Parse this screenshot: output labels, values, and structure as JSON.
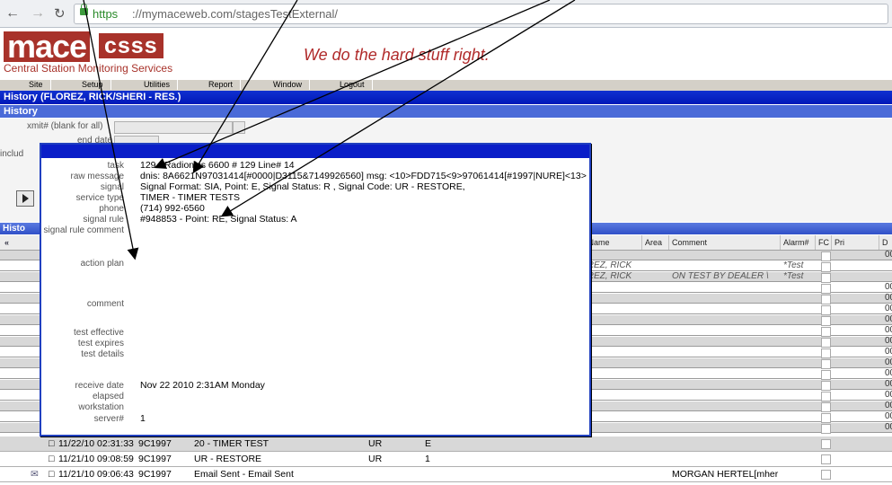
{
  "browser": {
    "back_icon": "back-arrow-icon",
    "forward_icon": "forward-arrow-icon",
    "reload_icon": "reload-icon",
    "url_scheme": "https",
    "url_rest": "://mymaceweb.com/stagesTestExternal/"
  },
  "branding": {
    "logo_main": "mace",
    "logo_secondary": "csss",
    "logo_subtitle": "Central Station Monitoring Services",
    "tagline": "We do the hard stuff right.",
    "brand_color": "#a8322a"
  },
  "menu": [
    "Site",
    "Setup",
    "Utilities",
    "Report",
    "Window",
    "Logout"
  ],
  "window": {
    "title": "History (FLOREZ, RICK/SHERI - RES.)",
    "section": "History"
  },
  "filters": {
    "xmit_label": "xmit# (blank for all)",
    "end_date_label": "end date",
    "include_label": "includ"
  },
  "grid": {
    "title": "Histo",
    "columns": [
      "r Name",
      "Area",
      "Comment",
      "Alarm#",
      "FC",
      "Pri",
      "D"
    ],
    "rows": [
      {
        "name": "",
        "comment": "",
        "alarm": "",
        "d": "00"
      },
      {
        "name": "OREZ, RICK",
        "comment": "",
        "alarm": "*Test",
        "d": ""
      },
      {
        "name": "OREZ, RICK",
        "comment": "ON TEST BY DEALER \\",
        "alarm": "*Test",
        "d": ""
      },
      {
        "name": "",
        "comment": "",
        "alarm": "",
        "d": "00"
      },
      {
        "name": "",
        "comment": "",
        "alarm": "",
        "d": "00"
      },
      {
        "name": "",
        "comment": "",
        "alarm": "",
        "d": "00"
      },
      {
        "name": "",
        "comment": "",
        "alarm": "",
        "d": "00"
      },
      {
        "name": "",
        "comment": "",
        "alarm": "",
        "d": "00"
      },
      {
        "name": "",
        "comment": "",
        "alarm": "",
        "d": "00"
      },
      {
        "name": "",
        "comment": "",
        "alarm": "",
        "d": "00"
      },
      {
        "name": "",
        "comment": "",
        "alarm": "",
        "d": "00"
      },
      {
        "name": "",
        "comment": "",
        "alarm": "",
        "d": "00"
      },
      {
        "name": "",
        "comment": "",
        "alarm": "",
        "d": "00"
      },
      {
        "name": "",
        "comment": "",
        "alarm": "",
        "d": "00"
      },
      {
        "name": "",
        "comment": "",
        "alarm": "",
        "d": "00"
      },
      {
        "name": "",
        "comment": "",
        "alarm": "",
        "d": "00"
      },
      {
        "name": "",
        "comment": "",
        "alarm": "",
        "d": "00"
      }
    ],
    "bottom_rows": [
      {
        "timestamp": "11/22/10 02:31:33",
        "xmit": "9C1997",
        "event": "20 - TIMER TEST",
        "code": "UR",
        "point": "E",
        "comment": ""
      },
      {
        "timestamp": "11/21/10 09:08:59",
        "xmit": "9C1997",
        "event": "UR - RESTORE",
        "code": "UR",
        "point": "1",
        "comment": ""
      },
      {
        "timestamp": "11/21/10 09:06:43",
        "xmit": "9C1997",
        "event": "Email Sent - Email Sent",
        "code": "",
        "point": "",
        "comment": "MORGAN HERTEL[mher"
      }
    ]
  },
  "detail": {
    "task_label": "task",
    "task_value": "129 - Radionics 6600 # 129   Line# 14",
    "raw_label": "raw message",
    "raw_value": "dnis: 8A6621N97031414[#0000|D3115&7149926560] msg: <10>FDD715<9>97061414[#1997|NURE]<13>",
    "signal_label": "signal",
    "signal_value": "Signal Format: SIA, Point: E, Signal Status: R , Signal Code: UR - RESTORE,",
    "service_label": "service type",
    "service_value": "TIMER - TIMER TESTS",
    "phone_label": "phone",
    "phone_value": "(714) 992-6560",
    "rule_label": "signal rule",
    "rule_value": "#948853 - Point: RE, Signal Status: A",
    "rule_comment_label": "signal rule comment",
    "action_label": "action plan",
    "comment_label": "comment",
    "test_eff_label": "test effective",
    "test_exp_label": "test expires",
    "test_det_label": "test details",
    "receive_label": "receive date",
    "receive_value": "Nov 22 2010  2:31AM Monday",
    "elapsed_label": "elapsed",
    "workstation_label": "workstation",
    "server_label": "server#",
    "server_value": "1"
  }
}
